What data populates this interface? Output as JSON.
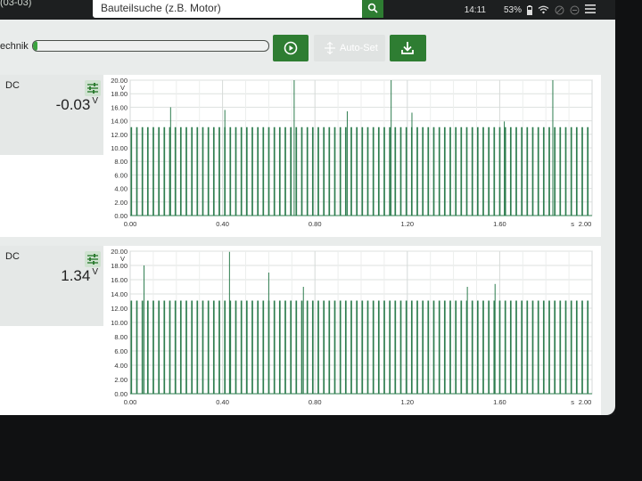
{
  "topbar": {
    "corner_label": "(03-03)",
    "search_placeholder": "Bauteilsuche (z.B. Motor)",
    "time": "14:11",
    "battery": "53%"
  },
  "toolbar": {
    "mode_label": "echnik",
    "progress_fraction": 0.02,
    "auto_set_label": "Auto-Set"
  },
  "channels": [
    {
      "title": "DC",
      "value": "-0.03",
      "unit": "V",
      "chart_data": {
        "type": "line",
        "y_unit_label": "V",
        "x_unit_label": "s",
        "xlim": [
          0,
          2.0
        ],
        "ylim": [
          0,
          20.0
        ],
        "x_ticks": [
          "0.00",
          "0.40",
          "0.80",
          "1.20",
          "1.60",
          "2.00"
        ],
        "y_ticks": [
          "0.00",
          "2.00",
          "4.00",
          "6.00",
          "8.00",
          "10.00",
          "12.00",
          "14.00",
          "16.00",
          "18.00",
          "20.00"
        ],
        "pulse_count": 84,
        "pulse_height": 13.0,
        "baseline": 0.0,
        "line_color": "#2e7d4f",
        "spikes": [
          {
            "t": 0.175,
            "v": 16.0
          },
          {
            "t": 0.41,
            "v": 15.6
          },
          {
            "t": 0.71,
            "v": 20.0
          },
          {
            "t": 0.94,
            "v": 15.4
          },
          {
            "t": 1.13,
            "v": 20.0
          },
          {
            "t": 1.22,
            "v": 15.2
          },
          {
            "t": 1.62,
            "v": 13.9
          },
          {
            "t": 1.83,
            "v": 20.0
          }
        ]
      }
    },
    {
      "title": "DC",
      "value": "1.34",
      "unit": "V",
      "chart_data": {
        "type": "line",
        "y_unit_label": "V",
        "x_unit_label": "s",
        "xlim": [
          0,
          2.0
        ],
        "ylim": [
          0,
          20.0
        ],
        "x_ticks": [
          "0.00",
          "0.40",
          "0.80",
          "1.20",
          "1.60",
          "2.00"
        ],
        "y_ticks": [
          "0.00",
          "2.00",
          "4.00",
          "6.00",
          "8.00",
          "10.00",
          "12.00",
          "14.00",
          "16.00",
          "18.00",
          "20.00"
        ],
        "pulse_count": 84,
        "pulse_height": 13.0,
        "baseline": 0.0,
        "line_color": "#2e7d4f",
        "spikes": [
          {
            "t": 0.06,
            "v": 18.0
          },
          {
            "t": 0.43,
            "v": 19.9
          },
          {
            "t": 0.6,
            "v": 17.0
          },
          {
            "t": 0.75,
            "v": 15.0
          },
          {
            "t": 1.46,
            "v": 15.0
          },
          {
            "t": 1.58,
            "v": 15.4
          }
        ]
      }
    }
  ]
}
